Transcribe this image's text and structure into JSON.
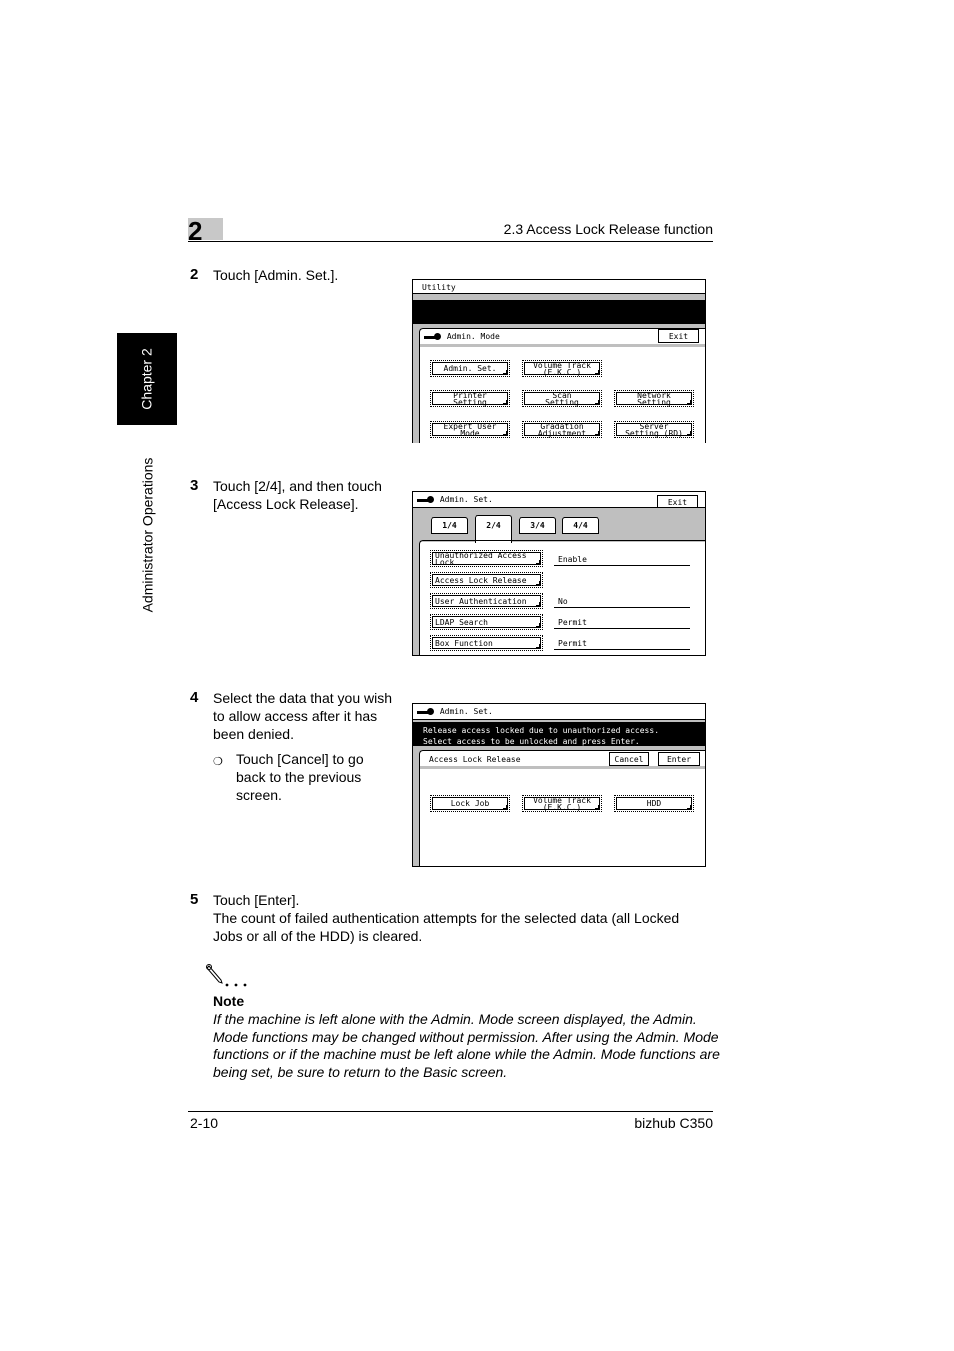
{
  "header": {
    "chapter_number": "2",
    "section_title": "2.3 Access Lock Release function"
  },
  "side_tab": {
    "chapter_label": "Chapter 2",
    "section_label": "Administrator Operations"
  },
  "steps": [
    {
      "number": "2",
      "text": "Touch [Admin. Set.]."
    },
    {
      "number": "3",
      "text_lines": [
        "Touch [2/4], and then touch",
        "[Access Lock Release]."
      ]
    },
    {
      "number": "4",
      "text_lines": [
        "Select the data that you wish",
        "to allow access after it has",
        "been denied."
      ],
      "sub_bullet": {
        "symbol": "❍",
        "text_lines": [
          "Touch [Cancel] to go",
          "back to the previous",
          "screen."
        ]
      }
    },
    {
      "number": "5",
      "text_lines": [
        "Touch [Enter].",
        "The count of failed authentication attempts for the selected data (all Locked",
        "Jobs or all of the HDD) is cleared."
      ]
    }
  ],
  "screen1": {
    "top_title": "Utility",
    "panel_title": "Admin. Mode",
    "exit_label": "Exit",
    "buttons": [
      "Admin. Set.",
      "Volume Track\n(E.K.C.)",
      "Printer\nSetting",
      "Scan\nSetting",
      "Network\nSetting",
      "Expert User\nMode",
      "Gradation\nAdjustment",
      "Server\nSetting (RD)"
    ]
  },
  "screen2": {
    "panel_title": "Admin. Set.",
    "exit_label": "Exit",
    "tabs": [
      "1/4",
      "2/4",
      "3/4",
      "4/4"
    ],
    "active_tab": "2/4",
    "rows": [
      {
        "label": "Unauthorized Access\nLock",
        "value": "Enable"
      },
      {
        "label": "Access Lock Release",
        "value": ""
      },
      {
        "label": "User Authentication",
        "value": "No"
      },
      {
        "label": "LDAP Search",
        "value": "Permit"
      },
      {
        "label": "Box Function",
        "value": "Permit"
      }
    ]
  },
  "screen3": {
    "panel_title": "Admin. Set.",
    "message_lines": [
      "Release access locked due to unauthorized access.",
      "Select access to be unlocked and press Enter."
    ],
    "sub_title": "Access Lock Release",
    "cancel_label": "Cancel",
    "enter_label": "Enter",
    "buttons": [
      "Lock Job",
      "Volume Track\n(E.K.C.)",
      "HDD"
    ]
  },
  "note": {
    "title": "Note",
    "icon": "pencil-note-icon",
    "body": "If the machine is left alone with the Admin. Mode screen displayed, the Admin. Mode functions may be changed without permission. After using the Admin. Mode functions or if the machine must be left alone while the Admin. Mode functions are being set, be sure to return to the Basic screen."
  },
  "footer": {
    "page_number": "2-10",
    "product": "bizhub C350"
  }
}
